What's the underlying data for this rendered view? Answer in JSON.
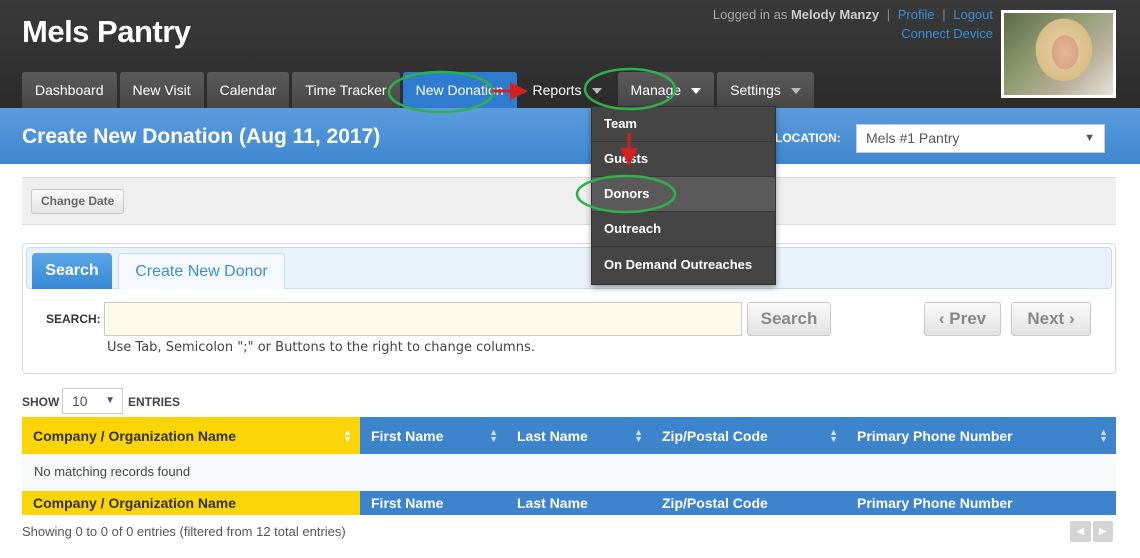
{
  "app": {
    "title": "Mels Pantry"
  },
  "user": {
    "logged_in_prefix": "Logged in as",
    "name": "Melody Manzy",
    "profile": "Profile",
    "separator": "|",
    "logout": "Logout",
    "connect_device": "Connect Device"
  },
  "nav": {
    "tabs": [
      {
        "label": "Dashboard"
      },
      {
        "label": "New Visit"
      },
      {
        "label": "Calendar"
      },
      {
        "label": "Time Tracker"
      },
      {
        "label": "New Donation",
        "active": true
      },
      {
        "label": "Reports",
        "has_dropdown": true
      },
      {
        "label": "Manage",
        "has_dropdown": true,
        "open": true
      },
      {
        "label": "Settings",
        "has_dropdown": true
      }
    ]
  },
  "manage_menu": {
    "items": [
      {
        "label": "Team"
      },
      {
        "label": "Guests"
      },
      {
        "label": "Donors",
        "highlighted": true
      },
      {
        "label": "Outreach"
      },
      {
        "label": "On Demand Outreaches"
      }
    ]
  },
  "page": {
    "title": "Create New Donation (Aug 11, 2017)",
    "location_label": "LOCATION:",
    "location_value": "Mels #1 Pantry",
    "location_arrow": "▼"
  },
  "date_strip": {
    "change_date": "Change Date"
  },
  "search_panel": {
    "tabs": {
      "search": "Search",
      "create": "Create New Donor"
    },
    "search_label": "SEARCH:",
    "search_value": "",
    "search_button": "Search",
    "prev_button": "‹ Prev",
    "next_button": "Next ›",
    "hint": "Use Tab, Semicolon \";\" or Buttons to the right to change columns."
  },
  "entries": {
    "show": "SHOW",
    "page_size": "10",
    "arrow": "▼",
    "entries": "ENTRIES"
  },
  "table": {
    "columns": [
      "Company / Organization Name",
      "First Name",
      "Last Name",
      "Zip/Postal Code",
      "Primary Phone Number"
    ],
    "sort_glyph": "▲▼",
    "empty_message": "No matching records found",
    "summary": "Showing 0 to 0 of 0 entries (filtered from 12 total entries)",
    "pager": {
      "prev": "◀",
      "next": "▶"
    }
  },
  "colors": {
    "header_bg": "#2f2f2f",
    "title_bar": "#4a90d6",
    "active_tab": "#2e7bcf",
    "first_column": "#fbd508",
    "column_header": "#3d84cc",
    "annotation_green": "#2db34a",
    "annotation_red": "#d62020"
  }
}
